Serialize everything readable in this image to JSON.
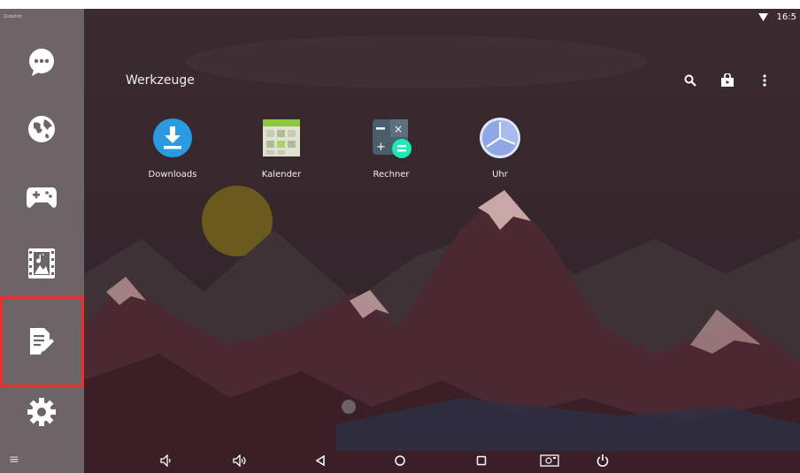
{
  "status_bar": {
    "time": "16:5",
    "wifi_icon": "wifi-icon"
  },
  "sidebar": {
    "tiny_label": "Zubehör",
    "items": [
      {
        "name": "messages",
        "icon": "chat-bubble-icon"
      },
      {
        "name": "browser",
        "icon": "globe-icon"
      },
      {
        "name": "games",
        "icon": "gamepad-icon"
      },
      {
        "name": "media",
        "icon": "media-icon"
      },
      {
        "name": "tools",
        "icon": "notes-edit-icon",
        "selected": true
      },
      {
        "name": "settings",
        "icon": "gear-icon"
      }
    ],
    "expand_icon": "double-chevron-down-icon"
  },
  "folder": {
    "title": "Werkzeuge",
    "actions": [
      "search-icon",
      "store-bag-icon",
      "more-vert-icon"
    ]
  },
  "apps": [
    {
      "label": "Downloads",
      "icon": "download-icon"
    },
    {
      "label": "Kalender",
      "icon": "calendar-icon"
    },
    {
      "label": "Rechner",
      "icon": "calculator-icon"
    },
    {
      "label": "Uhr",
      "icon": "clock-icon"
    }
  ],
  "navbar": {
    "buttons": [
      "volume-down-icon",
      "volume-up-icon",
      "back-icon",
      "home-icon",
      "recents-icon",
      "screenshot-icon",
      "power-icon"
    ]
  },
  "colors": {
    "highlight": "#e8302a",
    "sidebar": "#6c6467",
    "background": "#3a2a2f"
  }
}
